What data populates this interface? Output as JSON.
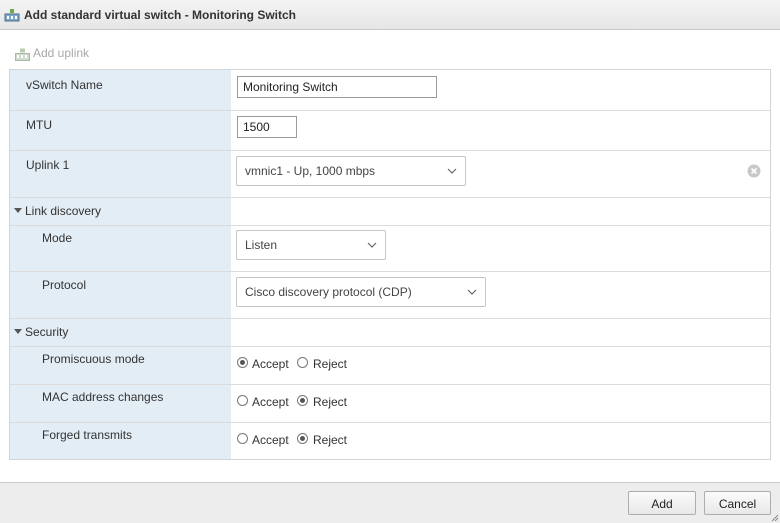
{
  "dialog": {
    "title": "Add standard virtual switch - Monitoring Switch"
  },
  "toolbar": {
    "add_uplink_label": "Add uplink"
  },
  "form": {
    "vswitch_name": {
      "label": "vSwitch Name",
      "value": "Monitoring Switch"
    },
    "mtu": {
      "label": "MTU",
      "value": "1500"
    },
    "uplink1": {
      "label": "Uplink 1",
      "value": "vmnic1 - Up, 1000 mbps"
    },
    "link_discovery": {
      "section_label": "Link discovery",
      "mode": {
        "label": "Mode",
        "value": "Listen"
      },
      "protocol": {
        "label": "Protocol",
        "value": "Cisco discovery protocol (CDP)"
      }
    },
    "security": {
      "section_label": "Security",
      "accept_label": "Accept",
      "reject_label": "Reject",
      "promiscuous": {
        "label": "Promiscuous mode",
        "selected": "Accept"
      },
      "mac_changes": {
        "label": "MAC address changes",
        "selected": "Reject"
      },
      "forged": {
        "label": "Forged transmits",
        "selected": "Reject"
      }
    }
  },
  "footer": {
    "add_label": "Add",
    "cancel_label": "Cancel"
  }
}
